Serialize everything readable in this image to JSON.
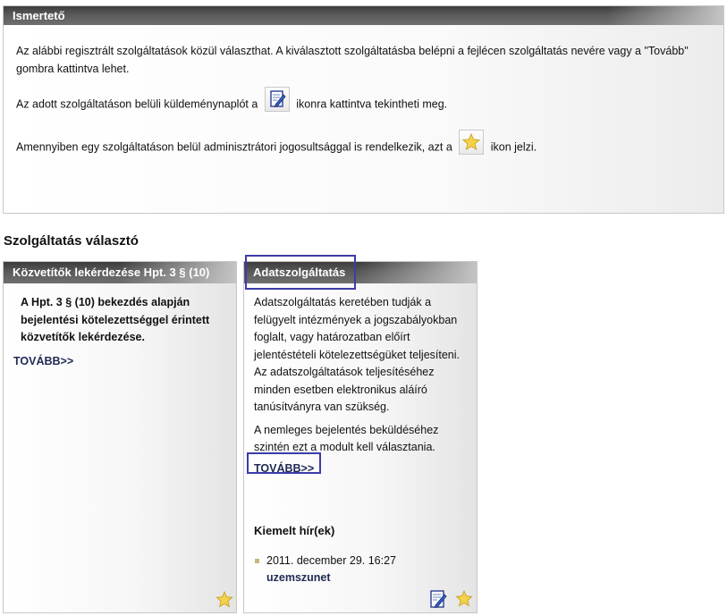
{
  "info": {
    "title": "Ismertető",
    "p1": "Az alábbi regisztrált szolgáltatások közül választhat. A kiválasztott szolgáltatásba belépni a fejlécen szolgáltatás nevére vagy a \"Tovább\" gombra kattintva lehet.",
    "p2_before": "Az adott szolgáltatáson belüli küldeménynaplót a",
    "p2_after": "ikonra kattintva tekintheti meg.",
    "p3_before": "Amennyiben egy szolgáltatáson belül adminisztrátori jogosultsággal is rendelkezik, azt a",
    "p3_after": "ikon jelzi."
  },
  "section_title": "Szolgáltatás választó",
  "services": [
    {
      "title": "Közvetítők lekérdezése Hpt. 3 § (10)",
      "description": "A Hpt. 3 § (10) bekezdés alapján bejelentési kötelezettséggel érintett közvetítők lekérdezése.",
      "more_label": "TOVÁBB>>"
    },
    {
      "title": "Adatszolgáltatás",
      "description1": "Adatszolgáltatás keretében tudják a felügyelt intézmények a jogszabályokban foglalt, vagy határozatban előírt jelentéstételi kötelezettségüket teljesíteni. Az adatszolgáltatások teljesítéséhez minden esetben elektronikus aláíró tanúsítványra van szükség.",
      "description2": "A nemleges bejelentés beküldéséhez szintén ezt a modult kell választania.",
      "more_label": "TOVÁBB>>",
      "news_title": "Kiemelt hír(ek)",
      "news": [
        {
          "date": "2011. december 29.  16:27",
          "title": "uzemszunet"
        }
      ]
    }
  ],
  "icons": {
    "log": "edit-notepad-icon",
    "admin": "star-icon"
  },
  "colors": {
    "header_dark": "#3c3c3c",
    "link": "#1f2a55",
    "highlight_border": "#3c3ca8",
    "star": "#f2cf3a"
  }
}
